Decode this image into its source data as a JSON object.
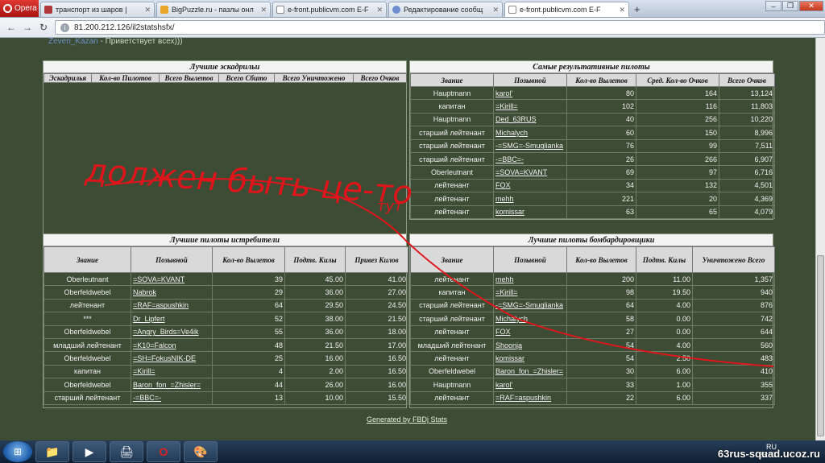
{
  "browser": {
    "brand": "Opera",
    "tabs": [
      {
        "title": "транспорт из шаров |"
      },
      {
        "title": "BigPuzzle.ru - пазлы онл"
      },
      {
        "title": "e-front.publicvm.com E-F"
      },
      {
        "title": "Редактирование сообщ"
      },
      {
        "title": "e-front.publicvm.com E-F",
        "active": true
      }
    ],
    "url": "81.200.212.126/il2statshsfx/"
  },
  "chat": {
    "user": "Zeven_Kazan",
    "message": "- Приветствует всех)))"
  },
  "squadrons": {
    "title": "Лучшие эскадрильи",
    "columns": [
      "Эскадрилья",
      "Кол-во Пилотов",
      "Всего Вылетов",
      "Всего Сбито",
      "Всего Уничтожено",
      "Всего Очков"
    ],
    "rows": []
  },
  "top_pilots": {
    "title": "Самые результативные пилоты",
    "columns": [
      "Звание",
      "Позывной",
      "Кол-во Вылетов",
      "Сред. Кол-во Очков",
      "Всего Очков"
    ],
    "rows": [
      [
        "Hauptmann",
        "karol'",
        "80",
        "164",
        "13,124"
      ],
      [
        "капитан",
        "=Kirill=",
        "102",
        "116",
        "11,803"
      ],
      [
        "Hauptmann",
        "Ded_63RUS",
        "40",
        "256",
        "10,220"
      ],
      [
        "старший лейтенант",
        "Michalych",
        "60",
        "150",
        "8,996"
      ],
      [
        "старший лейтенант",
        "-=SMG=-Smuglianka",
        "76",
        "99",
        "7,511"
      ],
      [
        "старший лейтенант",
        "-=BBC=-",
        "26",
        "266",
        "6,907"
      ],
      [
        "Oberleutnant",
        "=SOVA=KVANT",
        "69",
        "97",
        "6,716"
      ],
      [
        "лейтенант",
        "FOX",
        "34",
        "132",
        "4,501"
      ],
      [
        "лейтенант",
        "mehh",
        "221",
        "20",
        "4,369"
      ],
      [
        "лейтенант",
        "komissar",
        "63",
        "65",
        "4,079"
      ]
    ]
  },
  "fighter_pilots": {
    "title": "Лучшие пилоты истребители",
    "columns": [
      "Звание",
      "Позывной",
      "Кол-во Вылетов",
      "Подтв. Килы",
      "Привез Килов"
    ],
    "rows": [
      [
        "Oberleutnant",
        "=SOVA=KVANT",
        "39",
        "45.00",
        "41.00"
      ],
      [
        "Oberfeldwebel",
        "Nabrok",
        "29",
        "36.00",
        "27.00"
      ],
      [
        "лейтенант",
        "=RAF=aspushkin",
        "64",
        "29.50",
        "24.50"
      ],
      [
        "***",
        "Dr_Lipfert",
        "52",
        "38.00",
        "21.50"
      ],
      [
        "Oberfeldwebel",
        "=Angry_Birds=Ve4ik",
        "55",
        "36.00",
        "18.00"
      ],
      [
        "младший лейтенант",
        "=K10=Falcon",
        "48",
        "21.50",
        "17.00"
      ],
      [
        "Oberfeldwebel",
        "=SH=FokusNIK-DE",
        "25",
        "16.00",
        "16.50"
      ],
      [
        "капитан",
        "=Kirill=",
        "4",
        "2.00",
        "16.50"
      ],
      [
        "Oberfeldwebel",
        "Baron_fon_=Zhisler=",
        "44",
        "26.00",
        "16.00"
      ],
      [
        "старший лейтенант",
        "-=BBC=-",
        "13",
        "10.00",
        "15.50"
      ]
    ]
  },
  "bomber_pilots": {
    "title": "Лучшие пилоты бомбардировщики",
    "columns": [
      "Звание",
      "Позывной",
      "Кол-во Вылетов",
      "Подтв. Килы",
      "Уничтожено Всего"
    ],
    "rows": [
      [
        "лейтенант",
        "mehh",
        "200",
        "11.00",
        "1,357"
      ],
      [
        "капитан",
        "=Kirill=",
        "98",
        "19.50",
        "940"
      ],
      [
        "старший лейтенант",
        "-=SMG=-Smuglianka",
        "64",
        "4.00",
        "876"
      ],
      [
        "старший лейтенант",
        "Michalych",
        "58",
        "0.00",
        "742"
      ],
      [
        "лейтенант",
        "FOX",
        "27",
        "0.00",
        "644"
      ],
      [
        "младший лейтенант",
        "Shoonja",
        "54",
        "4.00",
        "560"
      ],
      [
        "лейтенант",
        "komissar",
        "54",
        "2.50",
        "483"
      ],
      [
        "Oberfeldwebel",
        "Baron_fon_=Zhisler=",
        "30",
        "6.00",
        "410"
      ],
      [
        "Hauptmann",
        "karol'",
        "33",
        "1.00",
        "355"
      ],
      [
        "лейтенант",
        "=RAF=aspushkin",
        "22",
        "6.00",
        "337"
      ]
    ]
  },
  "footer": {
    "generated": "Generated by FBDj Stats"
  },
  "annotation": {
    "line1": "должен быть це-то",
    "line2": "тут",
    "color": "#e0151b"
  },
  "taskbar": {
    "lang": "RU",
    "time": "23:07"
  },
  "watermark": "63rus-squad.ucoz.ru"
}
